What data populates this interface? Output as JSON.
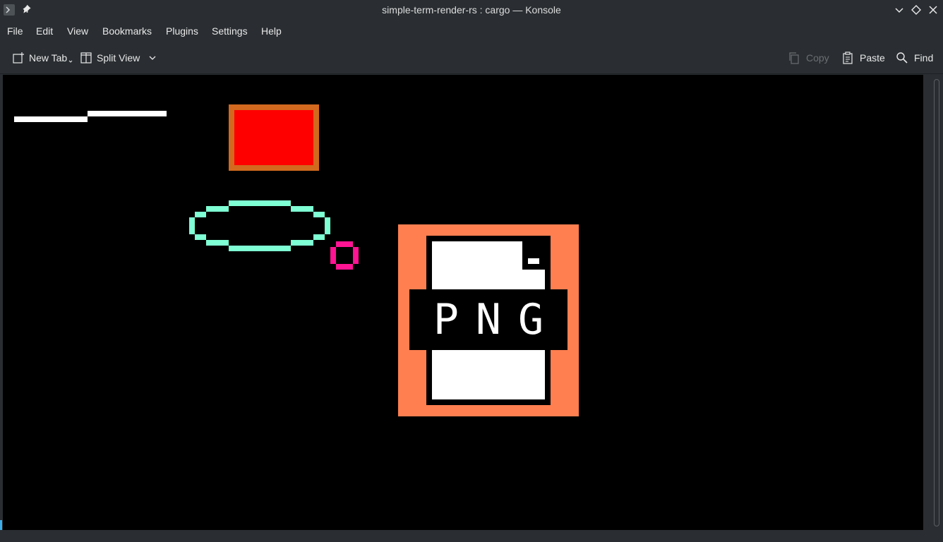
{
  "window": {
    "title": "simple-term-render-rs : cargo — Konsole"
  },
  "titlebar_buttons": [
    "chevron-down-icon",
    "diamond-icon",
    "close-icon"
  ],
  "menubar": {
    "items": [
      "File",
      "Edit",
      "View",
      "Bookmarks",
      "Plugins",
      "Settings",
      "Help"
    ]
  },
  "toolbar": {
    "new_tab_label": "New Tab",
    "split_view_label": "Split View",
    "copy_label": "Copy",
    "paste_label": "Paste",
    "find_label": "Find"
  },
  "terminal": {
    "background": "#000000",
    "file_icon_label": "PNG",
    "colors": {
      "line": "#ffffff",
      "rect_fill": "#ff0000",
      "rect_border": "#d2691e",
      "ellipse": "#7fffd4",
      "small_circle": "#ff1493",
      "png_bg": "#ff7f50",
      "png_sheet": "#ffffff",
      "png_band": "#000000"
    }
  },
  "colors": {
    "chrome_bg": "#2a2e32",
    "text": "#e8e8e8",
    "disabled_text": "#6b6e71",
    "accent": "#3daee9"
  }
}
